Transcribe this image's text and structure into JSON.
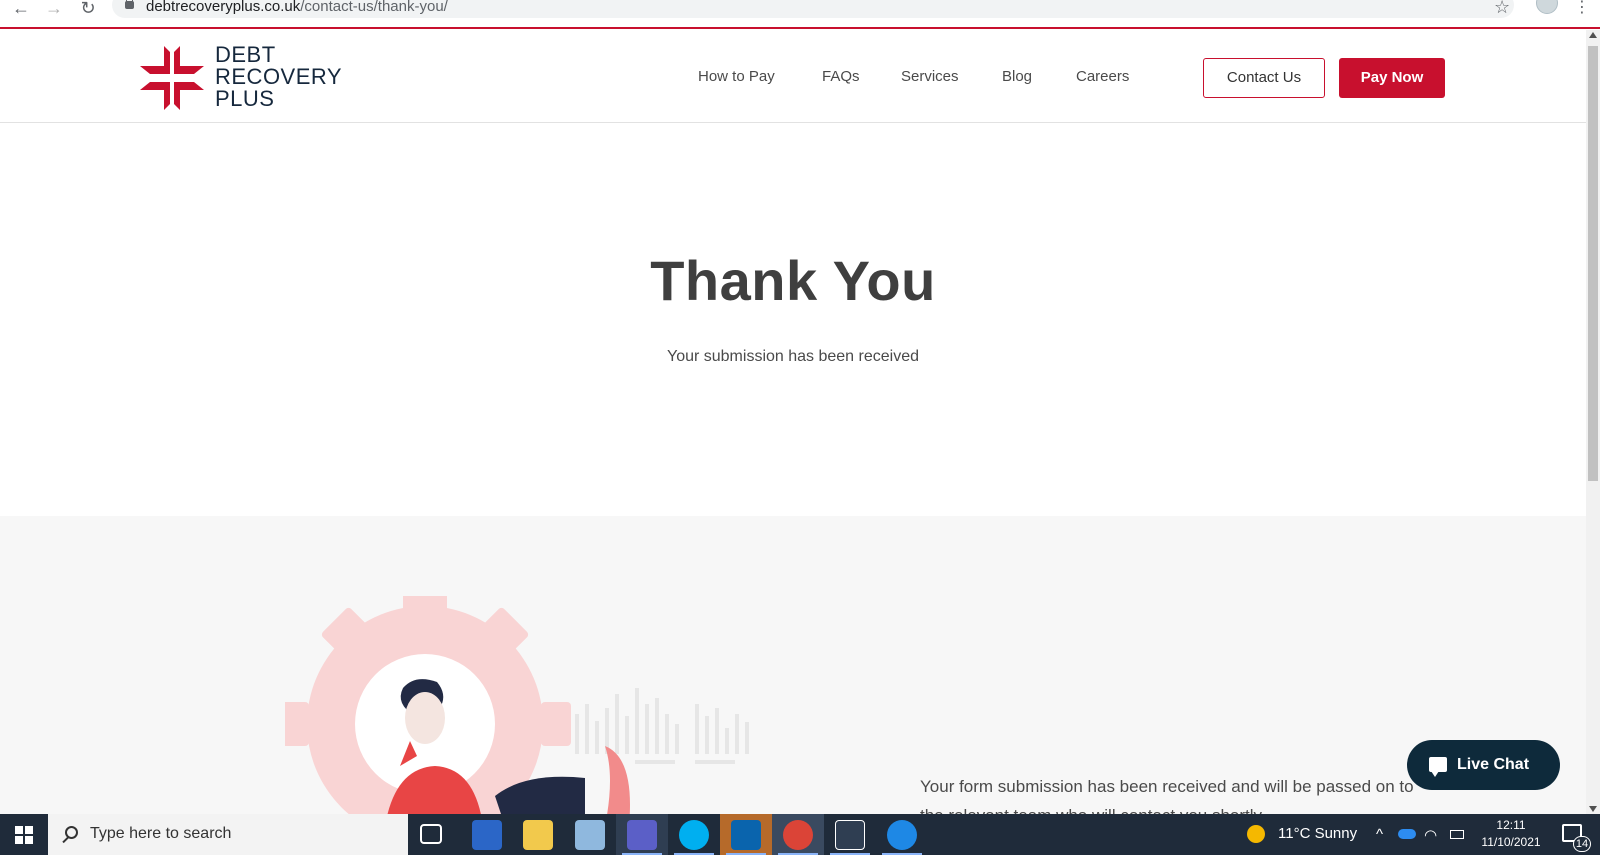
{
  "browser": {
    "url_domain": "debtrecoveryplus.co.uk",
    "url_path": "/contact-us/thank-you/",
    "back_icon": "←",
    "forward_icon": "→",
    "reload_icon": "↻",
    "star_icon": "☆",
    "menu_icon": "⋮"
  },
  "header": {
    "logo_line1": "DEBT",
    "logo_line2": "RECOVERY",
    "logo_line3": "PLUS",
    "nav": [
      {
        "label": "How to Pay"
      },
      {
        "label": "FAQs"
      },
      {
        "label": "Services"
      },
      {
        "label": "Blog"
      },
      {
        "label": "Careers"
      }
    ],
    "contact_label": "Contact Us",
    "pay_label": "Pay Now"
  },
  "hero": {
    "title": "Thank You",
    "subtitle": "Your submission has been received"
  },
  "lower": {
    "text": "Your form submission has been received and will be passed on to the relevant team who will contact you shortly."
  },
  "live_chat": {
    "label": "Live Chat"
  },
  "taskbar": {
    "search_placeholder": "Type here to search",
    "weather": "11°C  Sunny",
    "time": "12:11",
    "date": "11/10/2021",
    "notifications": "14"
  },
  "colors": {
    "brand_red": "#c8102e",
    "brand_navy": "#16283d",
    "chat_bg": "#0e2a3b",
    "taskbar_bg": "#1f2b3a"
  }
}
